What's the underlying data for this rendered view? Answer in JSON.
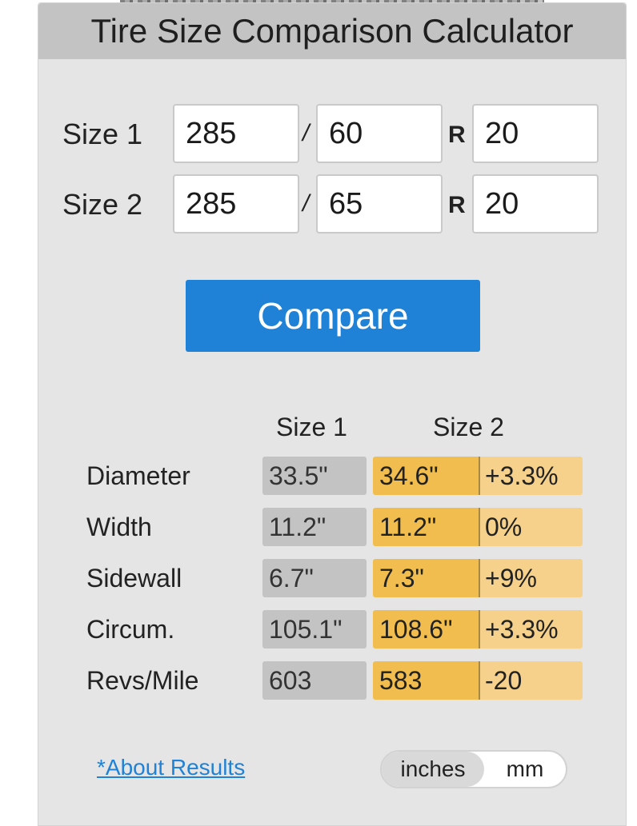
{
  "title": "Tire Size Comparison Calculator",
  "inputs": {
    "size1": {
      "label": "Size 1",
      "width": "285",
      "aspect": "60",
      "rim": "20"
    },
    "size2": {
      "label": "Size 2",
      "width": "285",
      "aspect": "65",
      "rim": "20"
    },
    "slash": "/",
    "r": "R"
  },
  "compare_button": "Compare",
  "results": {
    "headers": {
      "size1": "Size 1",
      "size2": "Size 2"
    },
    "rows": [
      {
        "label": "Diameter",
        "size1": "33.5\"",
        "size2": "34.6\"",
        "diff": "+3.3%"
      },
      {
        "label": "Width",
        "size1": "11.2\"",
        "size2": "11.2\"",
        "diff": "0%"
      },
      {
        "label": "Sidewall",
        "size1": "6.7\"",
        "size2": "7.3\"",
        "diff": "+9%"
      },
      {
        "label": "Circum.",
        "size1": "105.1\"",
        "size2": "108.6\"",
        "diff": "+3.3%"
      },
      {
        "label": "Revs/Mile",
        "size1": "603",
        "size2": "583",
        "diff": "-20"
      }
    ]
  },
  "about_link": "*About Results",
  "units": {
    "inches": "inches",
    "mm": "mm",
    "selected": "inches"
  },
  "colors": {
    "accent": "#1f82d6",
    "size1_cell": "#c3c3c3",
    "size2_cell": "#f0bd4e",
    "diff_cell": "#f5d18c",
    "title_bar": "#c3c3c3",
    "panel": "#e5e5e5"
  }
}
